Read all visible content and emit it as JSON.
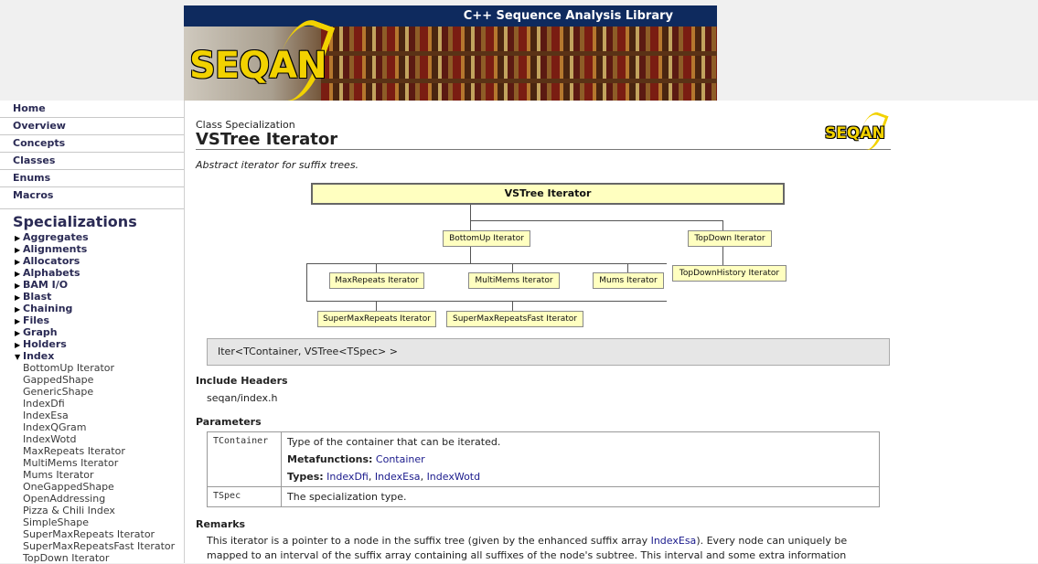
{
  "banner": {
    "title": "C++ Sequence Analysis Library",
    "logo_text": "SEQAN"
  },
  "sidebar": {
    "top_links": [
      "Home",
      "Overview",
      "Concepts",
      "Classes",
      "Enums",
      "Macros"
    ],
    "specializations_title": "Specializations",
    "categories": [
      "Aggregates",
      "Alignments",
      "Allocators",
      "Alphabets",
      "BAM I/O",
      "Blast",
      "Chaining",
      "Files",
      "Graph",
      "Holders"
    ],
    "open_category": "Index",
    "index_items": [
      "BottomUp Iterator",
      "GappedShape",
      "GenericShape",
      "IndexDfi",
      "IndexEsa",
      "IndexQGram",
      "IndexWotd",
      "MaxRepeats Iterator",
      "MultiMems Iterator",
      "Mums Iterator",
      "OneGappedShape",
      "OpenAddressing",
      "Pizza & Chili Index",
      "SimpleShape",
      "SuperMaxRepeats Iterator",
      "SuperMaxRepeatsFast Iterator",
      "TopDown Iterator"
    ]
  },
  "page": {
    "kind": "Class Specialization",
    "title": "VSTree Iterator",
    "logo_text": "SEQAN",
    "summary": "Abstract iterator for suffix trees."
  },
  "diagram": {
    "root": "VSTree Iterator",
    "bottomup": "BottomUp Iterator",
    "topdown": "TopDown Iterator",
    "maxrepeats": "MaxRepeats Iterator",
    "multimems": "MultiMems Iterator",
    "mums": "Mums Iterator",
    "topdownhistory": "TopDownHistory Iterator",
    "supermaxrepeats": "SuperMaxRepeats Iterator",
    "supermaxrepeatsfast": "SuperMaxRepeatsFast Iterator"
  },
  "signature": "Iter<TContainer, VSTree<TSpec> >",
  "include": {
    "heading": "Include Headers",
    "value": "seqan/index.h"
  },
  "parameters": {
    "heading": "Parameters",
    "rows": [
      {
        "name": "TContainer",
        "desc": "Type of the container that can be iterated.",
        "metafunctions_label": "Metafunctions:",
        "metafunctions": "Container",
        "types_label": "Types:",
        "types": [
          "IndexDfi",
          "IndexEsa",
          "IndexWotd"
        ]
      },
      {
        "name": "TSpec",
        "desc": "The specialization type."
      }
    ]
  },
  "remarks": {
    "heading": "Remarks",
    "text_before_link": "This iterator is a pointer to a node in the suffix tree (given by the enhanced suffix array ",
    "link": "IndexEsa",
    "text_after_link": "). Every node can uniquely be mapped to an interval of the suffix array containing all suffixes of the node's subtree. This interval and some extra information"
  }
}
